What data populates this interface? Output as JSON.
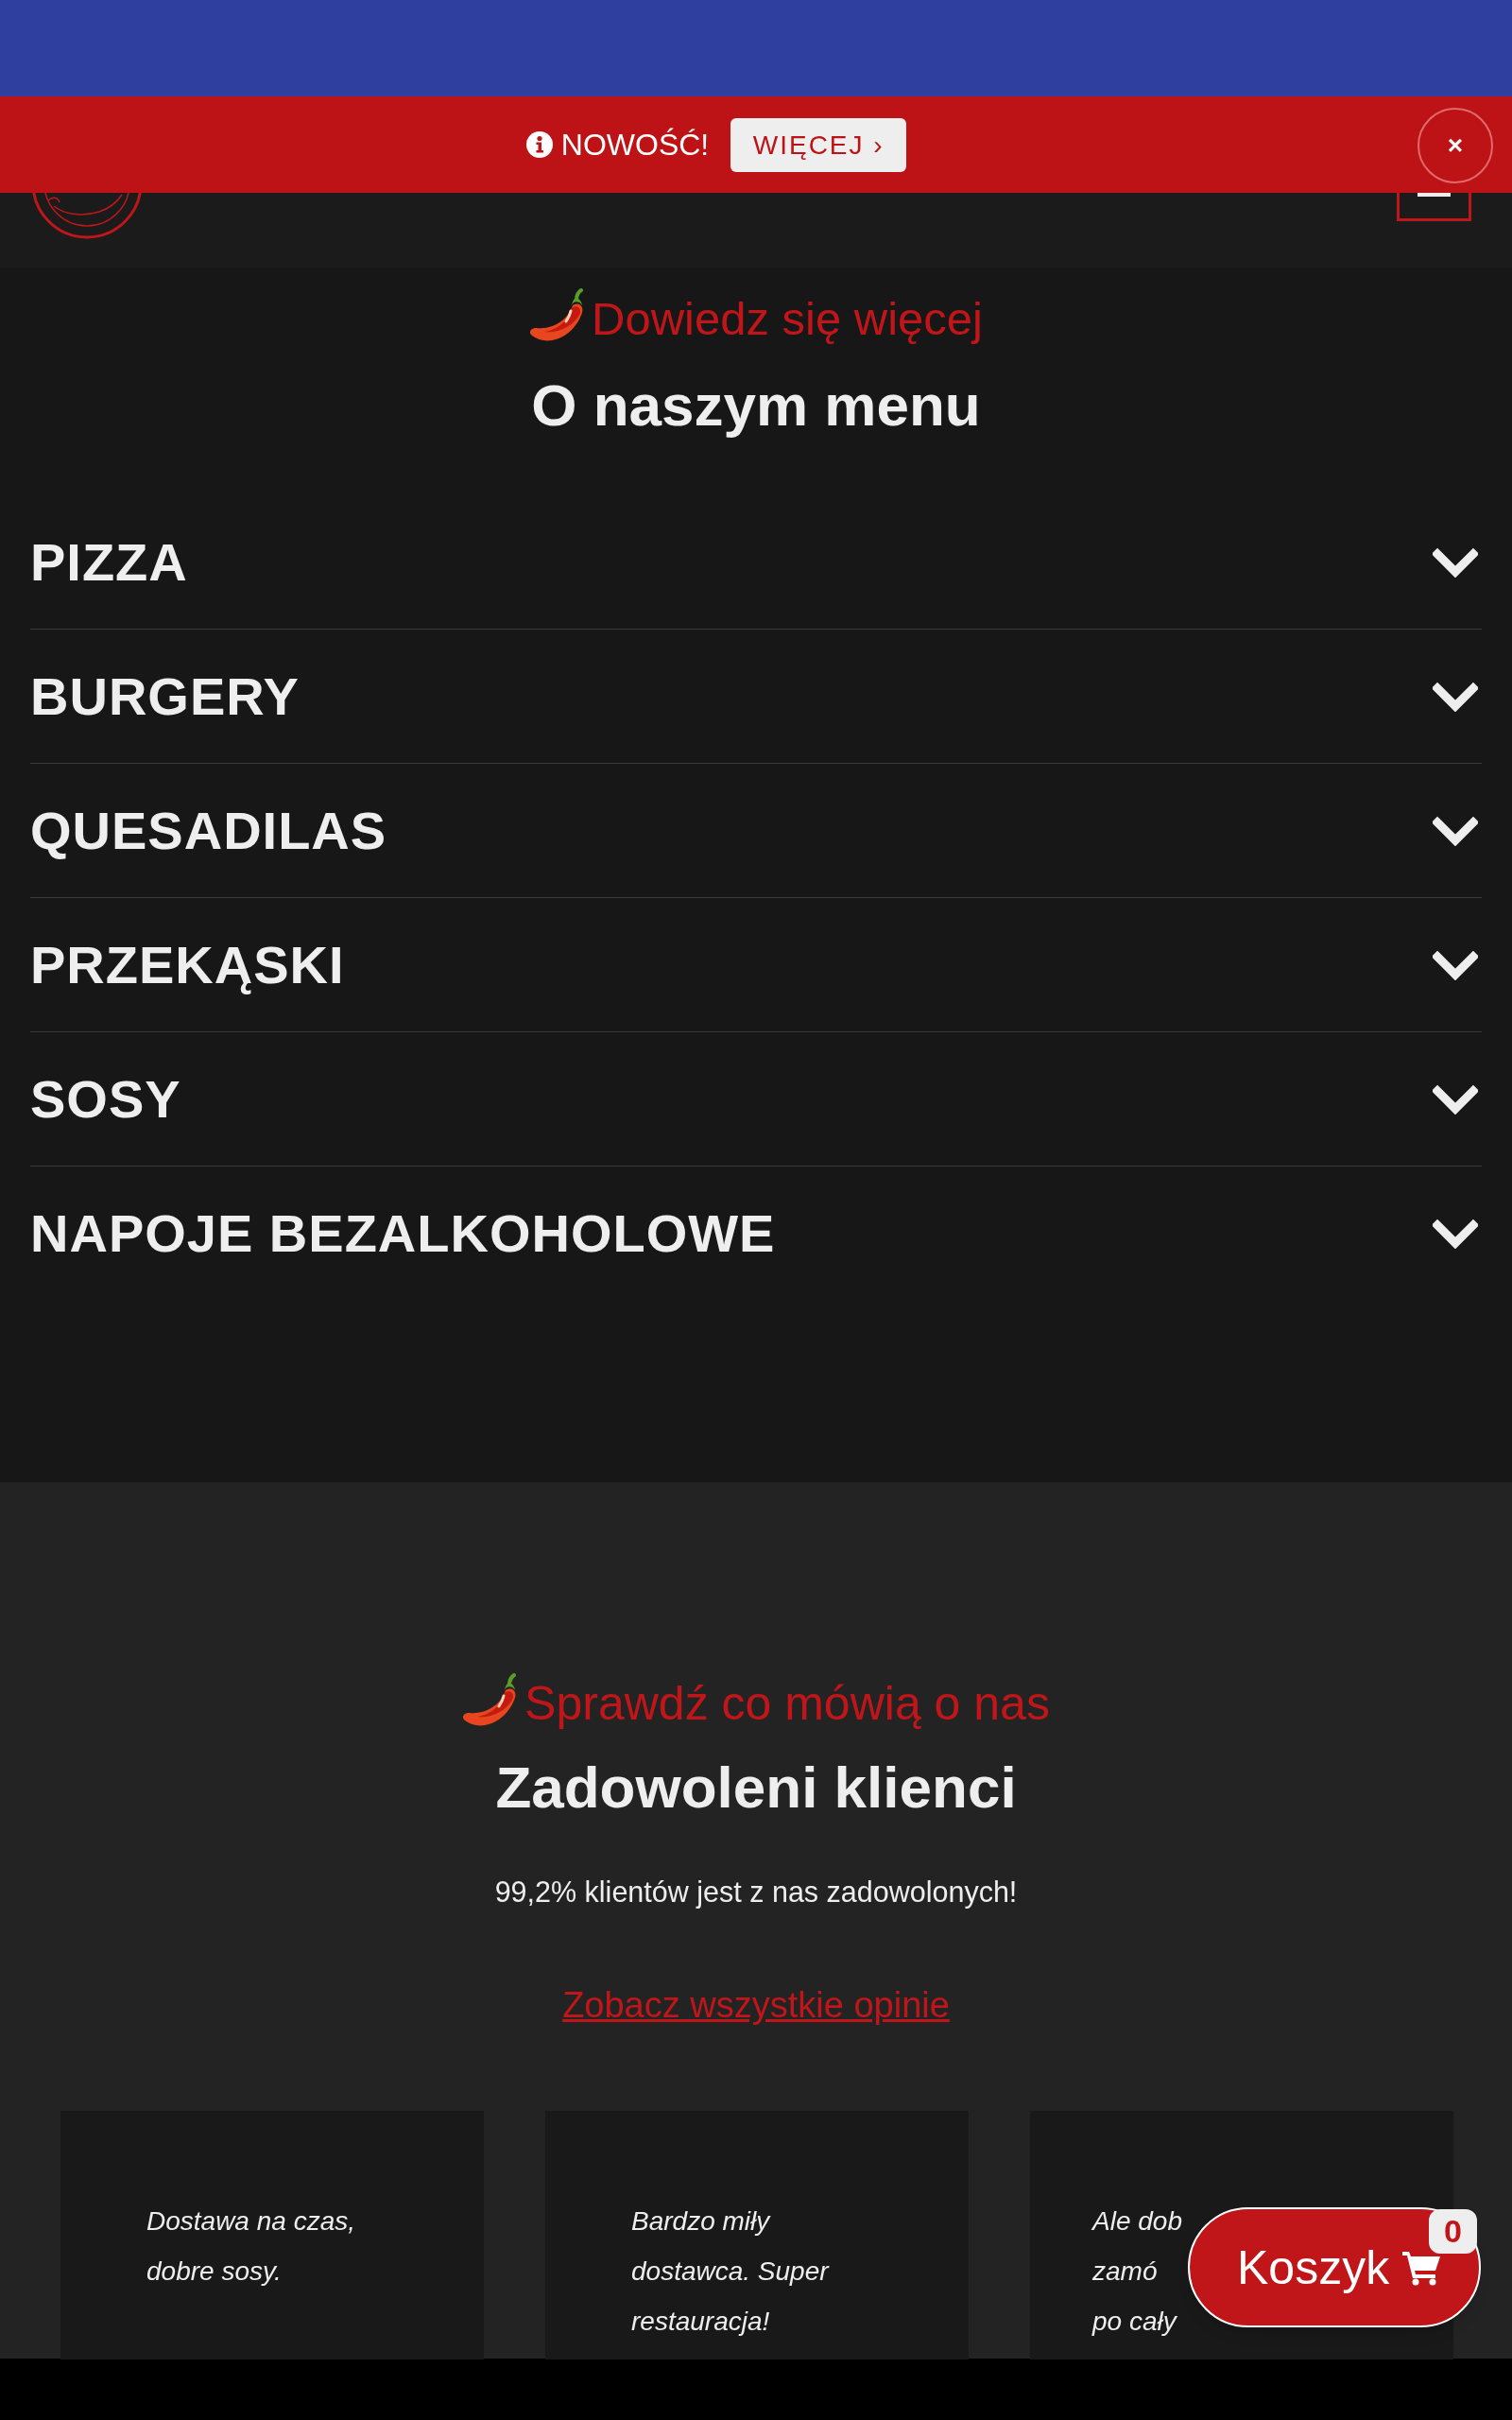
{
  "announcement": {
    "text": "NOWOŚĆ!",
    "button": "WIĘCEJ ›",
    "close": "×"
  },
  "menu_section": {
    "subtitle": "Dowiedz się więcej",
    "title": "O naszym menu",
    "categories": [
      {
        "label": "PIZZA",
        "expanded": false
      },
      {
        "label": "BURGERY",
        "expanded": false
      },
      {
        "label": "QUESADILAS",
        "expanded": false
      },
      {
        "label": "PRZEKĄSKI",
        "expanded": false
      },
      {
        "label": "SOSY",
        "expanded": false
      },
      {
        "label": "NAPOJE BEZALKOHOLOWE",
        "expanded": false
      }
    ]
  },
  "reviews_section": {
    "subtitle": "Sprawdź co mówią o nas",
    "title": "Zadowoleni klienci",
    "summary": "99,2% klientów jest z nas zadowolonych!",
    "link": "Zobacz wszystkie opinie",
    "reviews": [
      {
        "text": "Dostawa na czas,\ndobre sosy."
      },
      {
        "text": "Bardzo miły\ndostawca. Super\nrestauracja!"
      },
      {
        "text": "Ale dob\nzamó\npo cały"
      }
    ]
  },
  "cart_button": {
    "label": "Koszyk",
    "count": "0"
  }
}
